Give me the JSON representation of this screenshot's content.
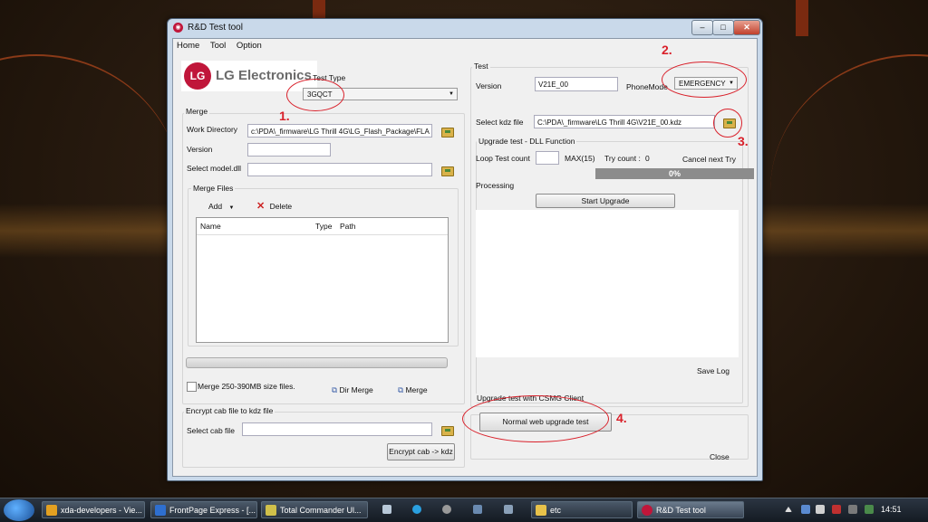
{
  "window": {
    "title": "R&D Test tool"
  },
  "menu": [
    "Home",
    "Tool",
    "Option"
  ],
  "logo": {
    "text": "LG Electronics",
    "mark": "LG"
  },
  "test_type": {
    "label": "Test Type",
    "value": "3GQCT"
  },
  "merge": {
    "legend": "Merge",
    "work_directory_label": "Work Directory",
    "work_directory_value": "c:\\PDA\\_firmware\\LG Thrill 4G\\LG_Flash_Package\\FLA",
    "version_label": "Version",
    "select_model_label": "Select model.dll",
    "merge_files_legend": "Merge Files",
    "add_label": "Add",
    "delete_label": "Delete",
    "columns": [
      "Name",
      "Type",
      "Path"
    ],
    "checkbox_label": "Merge 250-390MB size files.",
    "dir_merge_label": "Dir Merge",
    "merge_label": "Merge"
  },
  "encrypt": {
    "legend": "Encrypt cab file to kdz file",
    "select_cab_label": "Select cab file",
    "button_label": "Encrypt cab -> kdz"
  },
  "test": {
    "legend": "Test",
    "version_label": "Version",
    "version_value": "V21E_00",
    "phone_mode_label": "PhoneMode",
    "phone_mode_value": "EMERGENCY",
    "select_kdz_label": "Select kdz file",
    "kdz_value": "C:\\PDA\\_firmware\\LG Thrill 4G\\V21E_00.kdz",
    "dll_legend": "Upgrade test - DLL Function",
    "loop_label": "Loop Test count",
    "max_label": "MAX(15)",
    "try_count_label": "Try count :",
    "try_count_value": "0",
    "cancel_next_label": "Cancel next Try",
    "progress": "0%",
    "processing_label": "Processing",
    "start_upgrade_label": "Start Upgrade",
    "save_log_label": "Save Log",
    "csmg_legend": "Upgrade test with CSMG Client",
    "normal_web_label": "Normal web upgrade test",
    "close_label": "Close"
  },
  "annotations": [
    "1.",
    "2.",
    "3.",
    "4."
  ],
  "taskbar": {
    "items": [
      "xda-developers - Vie...",
      "FrontPage Express - [...",
      "Total Commander Ul...",
      "etc",
      "R&D Test tool"
    ],
    "clock": "14:51"
  },
  "colors": {
    "annotation": "#d9202a",
    "lg_red": "#c0163a"
  }
}
